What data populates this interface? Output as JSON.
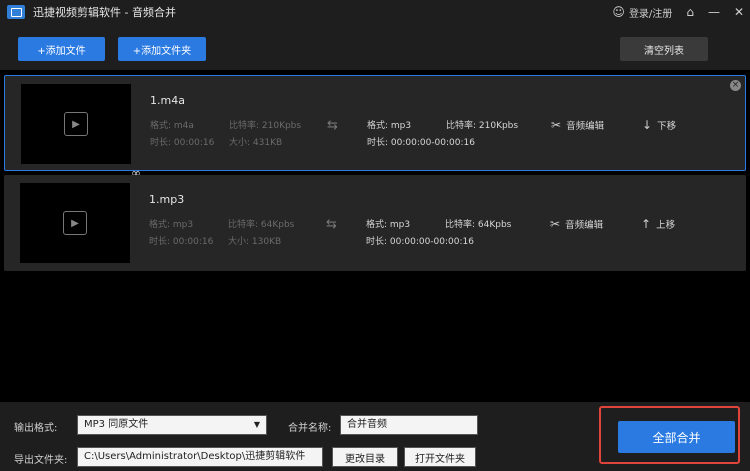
{
  "window": {
    "app_name": "迅捷视频剪辑软件",
    "separator": " - ",
    "module": "音频合并"
  },
  "title_actions": {
    "login_label": "登录/注册"
  },
  "toolbar": {
    "add_file": "+添加文件",
    "add_folder": "+添加文件夹",
    "clear_list": "清空列表"
  },
  "items": [
    {
      "filename": "1.m4a",
      "src_format": "格式: m4a",
      "src_bitrate": "比特率: 210Kpbs",
      "src_duration": "时长: 00:00:16",
      "src_size": "大小: 431KB",
      "dst_format": "格式: mp3",
      "dst_bitrate": "比特率: 210Kpbs",
      "dst_duration": "时长: 00:00:00-00:00:16",
      "edit_label": "音频编辑",
      "move_label": "下移",
      "move_arrow": "↓"
    },
    {
      "filename": "1.mp3",
      "src_format": "格式: mp3",
      "src_bitrate": "比特率: 64Kpbs",
      "src_duration": "时长: 00:00:16",
      "src_size": "大小: 130KB",
      "dst_format": "格式: mp3",
      "dst_bitrate": "比特率: 64Kpbs",
      "dst_duration": "时长: 00:00:00-00:00:16",
      "edit_label": "音频编辑",
      "move_label": "上移",
      "move_arrow": "↑"
    }
  ],
  "output": {
    "format_label": "输出格式:",
    "format_value": "MP3 同原文件",
    "name_label": "合并名称:",
    "name_value": "合并音频",
    "folder_label": "导出文件夹:",
    "folder_value": "C:\\Users\\Administrator\\Desktop\\迅捷剪辑软件",
    "change_dir": "更改目录",
    "open_folder": "打开文件夹",
    "merge_all": "全部合并"
  },
  "icons": [
    "app-logo-icon",
    "user-icon",
    "home-icon",
    "minimize-icon",
    "close-icon",
    "play-icon",
    "swap-icon",
    "scissors-icon",
    "arrow-icon",
    "link-icon",
    "chevron-down-icon"
  ],
  "colors": {
    "accent": "#2a7ae2",
    "highlight": "#e0443a",
    "panel": "#1e1e1e",
    "card": "#262626"
  }
}
